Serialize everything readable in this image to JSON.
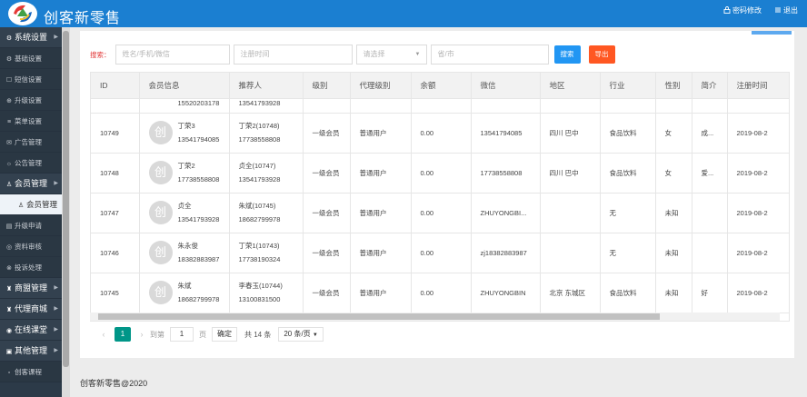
{
  "header": {
    "app_title": "创客新零售",
    "password_link": "密码修改",
    "logout_link": "退出"
  },
  "sidebar": {
    "items": [
      {
        "label": "系统设置",
        "icon": "gear-icon",
        "type": "group"
      },
      {
        "label": "基础设置",
        "icon": "settings-icon",
        "type": "sub"
      },
      {
        "label": "短信设置",
        "icon": "sms-icon",
        "type": "sub"
      },
      {
        "label": "升级设置",
        "icon": "upgrade-icon",
        "type": "sub"
      },
      {
        "label": "菜单设置",
        "icon": "menu-icon",
        "type": "sub"
      },
      {
        "label": "广告管理",
        "icon": "ad-icon",
        "type": "sub"
      },
      {
        "label": "公告管理",
        "icon": "announcement-icon",
        "type": "sub"
      },
      {
        "label": "会员管理",
        "icon": "users-icon",
        "type": "group"
      },
      {
        "label": "会员管理",
        "icon": "user-icon",
        "type": "active"
      },
      {
        "label": "升级申请",
        "icon": "apply-icon",
        "type": "sub"
      },
      {
        "label": "资料审核",
        "icon": "audit-icon",
        "type": "sub"
      },
      {
        "label": "投诉处理",
        "icon": "complaint-icon",
        "type": "sub"
      },
      {
        "label": "商盟管理",
        "icon": "alliance-icon",
        "type": "group"
      },
      {
        "label": "代理商城",
        "icon": "agent-mall-icon",
        "type": "group"
      },
      {
        "label": "在线课堂",
        "icon": "classroom-icon",
        "type": "group"
      },
      {
        "label": "其他管理",
        "icon": "other-icon",
        "type": "group"
      },
      {
        "label": "创客课程",
        "icon": "course-icon",
        "type": "sub"
      }
    ]
  },
  "filter": {
    "label": "搜索：",
    "name_placeholder": "姓名/手机/微信",
    "date_placeholder": "注册时间",
    "select_placeholder": "请选择",
    "city_placeholder": "省/市",
    "search_button": "搜索",
    "export_button": "导出"
  },
  "table": {
    "headers": [
      "ID",
      "会员信息",
      "推荐人",
      "级别",
      "代理级别",
      "余额",
      "微信",
      "地区",
      "行业",
      "性别",
      "简介",
      "注册时间"
    ],
    "partial_row": {
      "member_phone": "15520203178",
      "referrer_phone": "13541793928"
    },
    "rows": [
      {
        "id": "10749",
        "avatar": "创",
        "name": "丁荣3",
        "phone": "13541794085",
        "ref_name": "丁荣2(10748)",
        "ref_phone": "17738558808",
        "level": "一级会员",
        "agent": "普通用户",
        "balance": "0.00",
        "wechat": "13541794085",
        "region": "四川 巴中",
        "industry": "食品饮料",
        "gender": "女",
        "intro": "成...",
        "reg_time": "2019-08-2"
      },
      {
        "id": "10748",
        "avatar": "创",
        "name": "丁荣2",
        "phone": "17738558808",
        "ref_name": "贞全(10747)",
        "ref_phone": "13541793928",
        "level": "一级会员",
        "agent": "普通用户",
        "balance": "0.00",
        "wechat": "17738558808",
        "region": "四川 巴中",
        "industry": "食品饮料",
        "gender": "女",
        "intro": "爱...",
        "reg_time": "2019-08-2"
      },
      {
        "id": "10747",
        "avatar": "创",
        "name": "贞全",
        "phone": "13541793928",
        "ref_name": "朱斌(10745)",
        "ref_phone": "18682799978",
        "level": "一级会员",
        "agent": "普通用户",
        "balance": "0.00",
        "wechat": "ZHUYONGBI...",
        "region": "",
        "industry": "无",
        "gender": "未知",
        "intro": "",
        "reg_time": "2019-08-2"
      },
      {
        "id": "10746",
        "avatar": "创",
        "name": "朱永俊",
        "phone": "18382883987",
        "ref_name": "丁荣1(10743)",
        "ref_phone": "17738190324",
        "level": "一级会员",
        "agent": "普通用户",
        "balance": "0.00",
        "wechat": "zj18382883987",
        "region": "",
        "industry": "无",
        "gender": "未知",
        "intro": "",
        "reg_time": "2019-08-2"
      },
      {
        "id": "10745",
        "avatar": "创",
        "name": "朱斌",
        "phone": "18682799978",
        "ref_name": "李春玉(10744)",
        "ref_phone": "13100831500",
        "level": "一级会员",
        "agent": "普通用户",
        "balance": "0.00",
        "wechat": "ZHUYONGBIN",
        "region": "北京 东城区",
        "industry": "食品饮料",
        "gender": "未知",
        "intro": "好",
        "reg_time": "2019-08-2"
      }
    ]
  },
  "pager": {
    "current": "1",
    "goto_label": "到第",
    "goto_value": "1",
    "page_unit": "页",
    "confirm": "确定",
    "total": "共 14 条",
    "page_size": "20 条/页"
  },
  "footer": {
    "text": "创客新零售@2020"
  },
  "colors": {
    "header_bg": "#1b7fd1",
    "sidebar_bg": "#2c3a48",
    "search_btn": "#2196f3",
    "export_btn": "#ff5722",
    "pager_active": "#009688"
  }
}
